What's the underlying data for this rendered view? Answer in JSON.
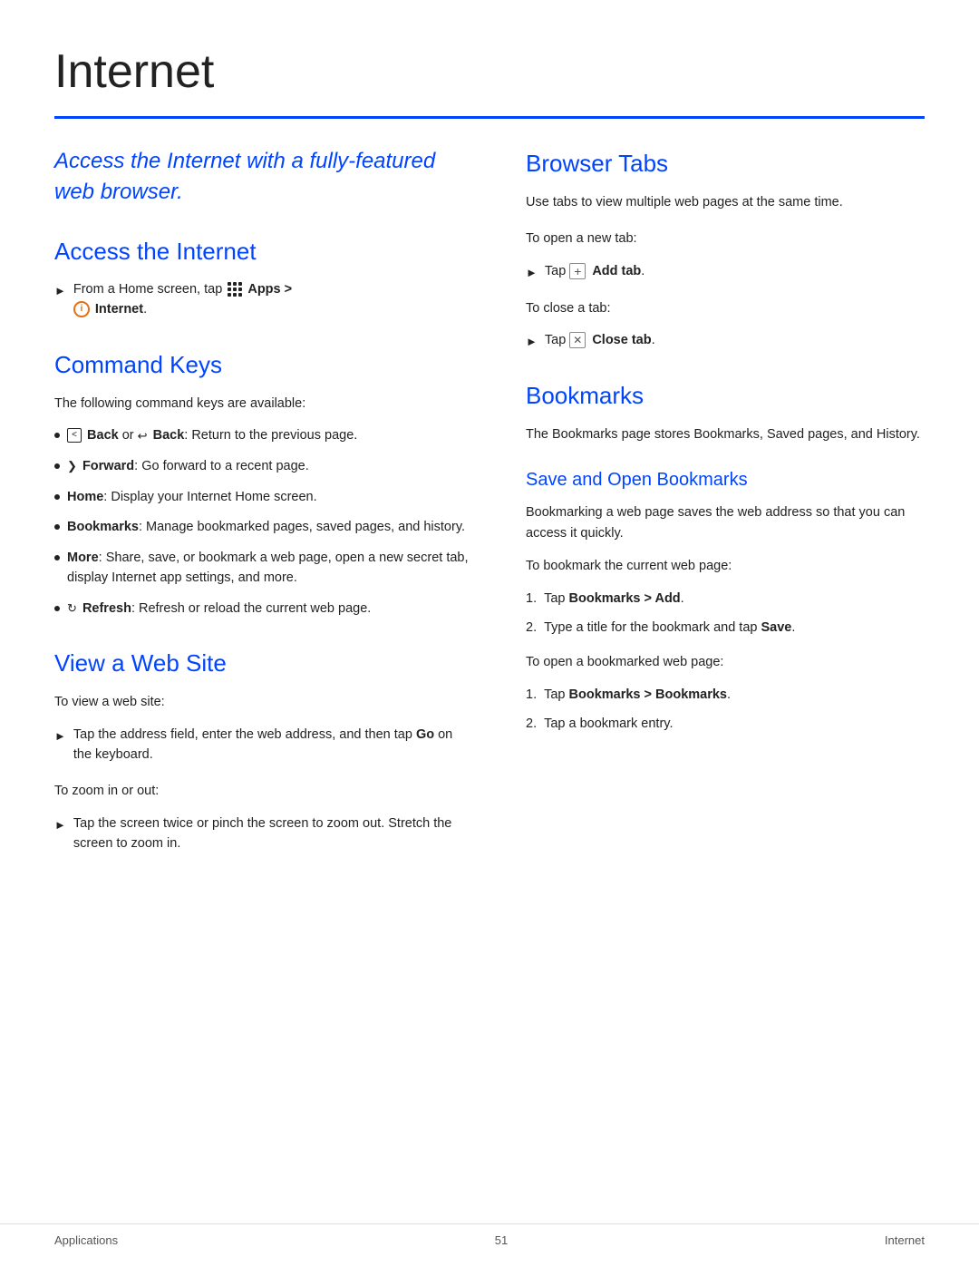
{
  "page": {
    "title": "Internet",
    "footer": {
      "left": "Applications",
      "center": "51",
      "right": "Internet"
    }
  },
  "intro": {
    "text": "Access the Internet with a fully-featured web browser."
  },
  "access_internet": {
    "heading": "Access the Internet",
    "step": "From a Home screen, tap",
    "apps_label": "Apps >",
    "internet_label": "Internet",
    "internet_symbol": "i"
  },
  "command_keys": {
    "heading": "Command Keys",
    "intro": "The following command keys are available:",
    "items": [
      {
        "text_before": "",
        "bold": "Back",
        "text_middle": " or ",
        "bold2": "Back",
        "text_after": ": Return to the previous page."
      },
      {
        "bold": "Forward",
        "text_after": ": Go forward to a recent page."
      },
      {
        "bold": "Home",
        "text_after": ": Display your Internet Home screen."
      },
      {
        "bold": "Bookmarks",
        "text_after": ": Manage bookmarked pages, saved pages, and history."
      },
      {
        "bold": "More",
        "text_after": ": Share, save, or bookmark a web page, open a new secret tab, display Internet app settings, and more."
      },
      {
        "bold": "Refresh",
        "text_after": ": Refresh or reload the current web page."
      }
    ]
  },
  "view_web_site": {
    "heading": "View a Web Site",
    "to_view_label": "To view a web site:",
    "step1": "Tap the address field, enter the web address, and then tap",
    "step1_bold": "Go",
    "step1_end": "on the keyboard.",
    "to_zoom_label": "To zoom in or out:",
    "step2": "Tap the screen twice or pinch the screen to zoom out. Stretch the screen to zoom in."
  },
  "browser_tabs": {
    "heading": "Browser Tabs",
    "description": "Use tabs to view multiple web pages at the same time.",
    "new_tab_label": "To open a new tab:",
    "new_tab_step": "Tap",
    "new_tab_bold": "Add tab",
    "close_tab_label": "To close a tab:",
    "close_tab_step": "Tap",
    "close_tab_bold": "Close tab"
  },
  "bookmarks": {
    "heading": "Bookmarks",
    "description": "The Bookmarks page stores Bookmarks, Saved pages, and History.",
    "save_open_heading": "Save and Open Bookmarks",
    "save_open_description": "Bookmarking a web page saves the web address so that you can access it quickly.",
    "bookmark_current_label": "To bookmark the current web page:",
    "bookmark_steps": [
      {
        "num": "1.",
        "text_before": "Tap ",
        "bold": "Bookmarks > Add",
        "text_after": "."
      },
      {
        "num": "2.",
        "text_before": "Type a title for the bookmark and tap ",
        "bold": "Save",
        "text_after": "."
      }
    ],
    "open_bookmarked_label": "To open a bookmarked web page:",
    "open_steps": [
      {
        "num": "1.",
        "text_before": "Tap ",
        "bold": "Bookmarks > Bookmarks",
        "text_after": "."
      },
      {
        "num": "2.",
        "text_before": "Tap a bookmark entry.",
        "bold": "",
        "text_after": ""
      }
    ]
  }
}
